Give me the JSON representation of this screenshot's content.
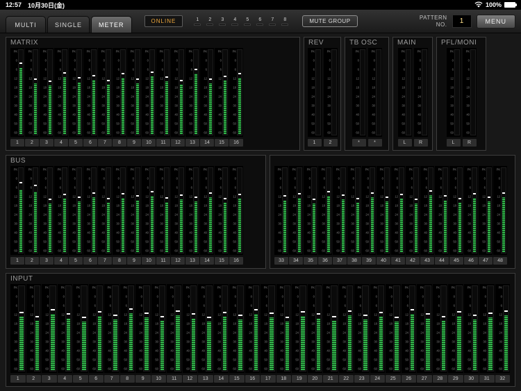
{
  "status_bar": {
    "time": "12:57",
    "date": "10月30日(金)",
    "battery": "100%",
    "wifi_icon": "wifi",
    "battery_icon": "battery"
  },
  "tab_bar": {
    "tabs": [
      {
        "label": "MULTI",
        "active": false
      },
      {
        "label": "SINGLE",
        "active": false
      },
      {
        "label": "METER",
        "active": true
      }
    ],
    "online_label": "ONLINE",
    "channel_indicators": [
      "1",
      "2",
      "3",
      "4",
      "5",
      "6",
      "7",
      "8"
    ],
    "mute_group_label": "MUTE GROUP",
    "pattern_label_line1": "PATTERN",
    "pattern_label_line2": "NO.",
    "pattern_value": "1",
    "menu_label": "MENU"
  },
  "colors": {
    "meter_green": "#32b44a",
    "peak_white": "#ffffff",
    "online_orange": "#eda73c",
    "pattern_value_color": "#ffe08a"
  },
  "meter_scale": [
    "PK",
    "0",
    "6",
    "12",
    "18",
    "24",
    "30",
    "40",
    "50",
    "60"
  ],
  "sections": [
    {
      "id": "matrix",
      "title": "MATRIX",
      "meters": [
        {
          "label": "1",
          "level": 78,
          "peak": 84
        },
        {
          "label": "2",
          "level": 60,
          "peak": 65
        },
        {
          "label": "3",
          "level": 57,
          "peak": 62
        },
        {
          "label": "4",
          "level": 67,
          "peak": 72
        },
        {
          "label": "5",
          "level": 61,
          "peak": 66
        },
        {
          "label": "6",
          "level": 64,
          "peak": 69
        },
        {
          "label": "7",
          "level": 58,
          "peak": 63
        },
        {
          "label": "8",
          "level": 66,
          "peak": 71
        },
        {
          "label": "9",
          "level": 60,
          "peak": 65
        },
        {
          "label": "10",
          "level": 68,
          "peak": 73
        },
        {
          "label": "11",
          "level": 62,
          "peak": 67
        },
        {
          "label": "12",
          "level": 58,
          "peak": 63
        },
        {
          "label": "13",
          "level": 71,
          "peak": 76
        },
        {
          "label": "14",
          "level": 60,
          "peak": 65
        },
        {
          "label": "15",
          "level": 63,
          "peak": 68
        },
        {
          "label": "16",
          "level": 66,
          "peak": 71
        }
      ]
    },
    {
      "id": "rev",
      "title": "REV",
      "meters": [
        {
          "label": "1",
          "level": 0,
          "peak": null
        },
        {
          "label": "2",
          "level": 0,
          "peak": null
        }
      ]
    },
    {
      "id": "tbosc",
      "title": "TB OSC",
      "meters": [
        {
          "label": "*",
          "level": 0,
          "peak": null
        },
        {
          "label": "*",
          "level": 0,
          "peak": null
        }
      ]
    },
    {
      "id": "main",
      "title": "MAIN",
      "meters": [
        {
          "label": "L",
          "level": 0,
          "peak": null
        },
        {
          "label": "R",
          "level": 0,
          "peak": null
        }
      ]
    },
    {
      "id": "pfl",
      "title": "PFL/MONI",
      "meters": [
        {
          "label": "L",
          "level": 0,
          "peak": null
        },
        {
          "label": "R",
          "level": 0,
          "peak": null
        }
      ]
    },
    {
      "id": "bus",
      "title": "BUS",
      "meters": [
        {
          "label": "1",
          "level": 74,
          "peak": 82
        },
        {
          "label": "2",
          "level": 71,
          "peak": 79
        },
        {
          "label": "3",
          "level": 57,
          "peak": 62
        },
        {
          "label": "4",
          "level": 63,
          "peak": 68
        },
        {
          "label": "5",
          "level": 60,
          "peak": 65
        },
        {
          "label": "6",
          "level": 65,
          "peak": 70
        },
        {
          "label": "7",
          "level": 58,
          "peak": 63
        },
        {
          "label": "8",
          "level": 64,
          "peak": 69
        },
        {
          "label": "9",
          "level": 61,
          "peak": 66
        },
        {
          "label": "10",
          "level": 66,
          "peak": 71
        },
        {
          "label": "11",
          "level": 59,
          "peak": 64
        },
        {
          "label": "12",
          "level": 62,
          "peak": 67
        },
        {
          "label": "13",
          "level": 60,
          "peak": 65
        },
        {
          "label": "14",
          "level": 65,
          "peak": 70
        },
        {
          "label": "15",
          "level": 58,
          "peak": 63
        },
        {
          "label": "16",
          "level": 63,
          "peak": 68
        }
      ]
    },
    {
      "id": "bus2",
      "title": "",
      "meters": [
        {
          "label": "33",
          "level": 61,
          "peak": 66
        },
        {
          "label": "34",
          "level": 64,
          "peak": 69
        },
        {
          "label": "35",
          "level": 57,
          "peak": 62
        },
        {
          "label": "36",
          "level": 66,
          "peak": 71
        },
        {
          "label": "37",
          "level": 62,
          "peak": 67
        },
        {
          "label": "38",
          "level": 58,
          "peak": 63
        },
        {
          "label": "39",
          "level": 65,
          "peak": 70
        },
        {
          "label": "40",
          "level": 60,
          "peak": 65
        },
        {
          "label": "41",
          "level": 63,
          "peak": 68
        },
        {
          "label": "42",
          "level": 57,
          "peak": 62
        },
        {
          "label": "43",
          "level": 67,
          "peak": 72
        },
        {
          "label": "44",
          "level": 61,
          "peak": 66
        },
        {
          "label": "45",
          "level": 58,
          "peak": 63
        },
        {
          "label": "46",
          "level": 64,
          "peak": 69
        },
        {
          "label": "47",
          "level": 60,
          "peak": 65
        },
        {
          "label": "48",
          "level": 65,
          "peak": 70
        }
      ]
    },
    {
      "id": "input",
      "title": "INPUT",
      "meters": [
        {
          "label": "1",
          "level": 63,
          "peak": 68
        },
        {
          "label": "2",
          "level": 58,
          "peak": 63
        },
        {
          "label": "3",
          "level": 66,
          "peak": 71
        },
        {
          "label": "4",
          "level": 61,
          "peak": 66
        },
        {
          "label": "5",
          "level": 57,
          "peak": 62
        },
        {
          "label": "6",
          "level": 64,
          "peak": 69
        },
        {
          "label": "7",
          "level": 60,
          "peak": 65
        },
        {
          "label": "8",
          "level": 67,
          "peak": 72
        },
        {
          "label": "9",
          "level": 62,
          "peak": 67
        },
        {
          "label": "10",
          "level": 58,
          "peak": 63
        },
        {
          "label": "11",
          "level": 65,
          "peak": 70
        },
        {
          "label": "12",
          "level": 61,
          "peak": 66
        },
        {
          "label": "13",
          "level": 57,
          "peak": 62
        },
        {
          "label": "14",
          "level": 63,
          "peak": 68
        },
        {
          "label": "15",
          "level": 60,
          "peak": 65
        },
        {
          "label": "16",
          "level": 66,
          "peak": 71
        },
        {
          "label": "17",
          "level": 62,
          "peak": 67
        },
        {
          "label": "18",
          "level": 57,
          "peak": 62
        },
        {
          "label": "19",
          "level": 64,
          "peak": 69
        },
        {
          "label": "20",
          "level": 61,
          "peak": 66
        },
        {
          "label": "21",
          "level": 58,
          "peak": 63
        },
        {
          "label": "22",
          "level": 65,
          "peak": 70
        },
        {
          "label": "23",
          "level": 60,
          "peak": 65
        },
        {
          "label": "24",
          "level": 63,
          "peak": 68
        },
        {
          "label": "25",
          "level": 57,
          "peak": 62
        },
        {
          "label": "26",
          "level": 66,
          "peak": 71
        },
        {
          "label": "27",
          "level": 61,
          "peak": 66
        },
        {
          "label": "28",
          "level": 58,
          "peak": 63
        },
        {
          "label": "29",
          "level": 64,
          "peak": 69
        },
        {
          "label": "30",
          "level": 60,
          "peak": 65
        },
        {
          "label": "31",
          "level": 62,
          "peak": 67
        },
        {
          "label": "32",
          "level": 65,
          "peak": 70
        }
      ]
    }
  ]
}
